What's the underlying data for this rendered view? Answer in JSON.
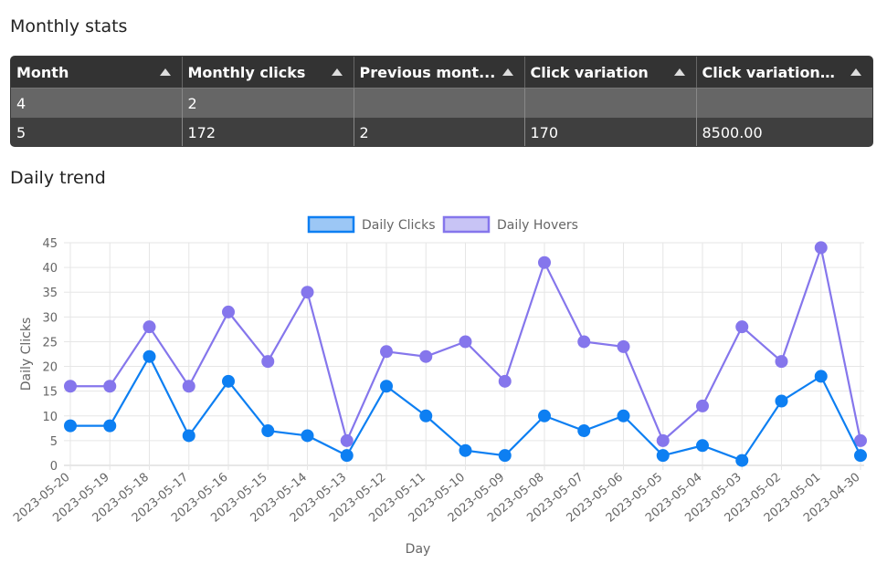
{
  "sections": {
    "monthly_title": "Monthly stats",
    "daily_title": "Daily trend"
  },
  "table": {
    "columns": [
      "Month",
      "Monthly clicks",
      "Previous mont...",
      "Click variation",
      "Click variation p..."
    ],
    "rows": [
      [
        "4",
        "2",
        "",
        "",
        ""
      ],
      [
        "5",
        "172",
        "2",
        "170",
        "8500.00"
      ]
    ]
  },
  "chart_data": {
    "type": "line",
    "categories": [
      "2023-05-20",
      "2023-05-19",
      "2023-05-18",
      "2023-05-17",
      "2023-05-16",
      "2023-05-15",
      "2023-05-14",
      "2023-05-13",
      "2023-05-12",
      "2023-05-11",
      "2023-05-10",
      "2023-05-09",
      "2023-05-08",
      "2023-05-07",
      "2023-05-06",
      "2023-05-05",
      "2023-05-04",
      "2023-05-03",
      "2023-05-02",
      "2023-05-01",
      "2023-04-30"
    ],
    "series": [
      {
        "name": "Daily Clicks",
        "color": "#0d7ff2",
        "fill": "#9cc7f5",
        "values": [
          8,
          8,
          22,
          6,
          17,
          7,
          6,
          2,
          16,
          10,
          3,
          2,
          10,
          7,
          10,
          2,
          4,
          1,
          13,
          18,
          2
        ]
      },
      {
        "name": "Daily Hovers",
        "color": "#8576ec",
        "fill": "#c8c4f5",
        "values": [
          16,
          16,
          28,
          16,
          31,
          21,
          35,
          5,
          23,
          22,
          25,
          17,
          41,
          25,
          24,
          5,
          12,
          28,
          21,
          44,
          5
        ]
      }
    ],
    "xlabel": "Day",
    "ylabel": "Daily Clicks",
    "ylim": [
      0,
      45
    ],
    "yticks": [
      0,
      5,
      10,
      15,
      20,
      25,
      30,
      35,
      40,
      45
    ],
    "grid": true,
    "legend": "top-center"
  }
}
